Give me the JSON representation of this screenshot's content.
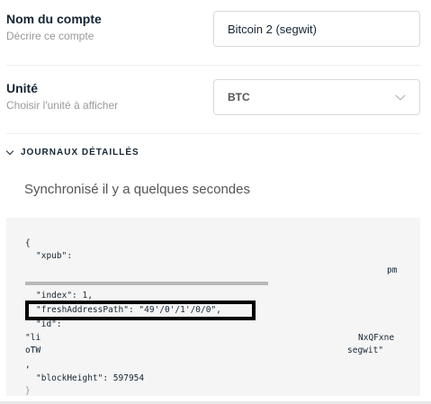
{
  "account_name": {
    "title": "Nom du compte",
    "description": "Décrire ce compte",
    "value": "Bitcoin 2 (segwit)"
  },
  "unit": {
    "title": "Unité",
    "description": "Choisir l'unité à afficher",
    "selected": "BTC"
  },
  "logs": {
    "toggle_label": "JOURNAUX DÉTAILLÉS",
    "sync_status": "Synchronisé il y a quelques secondes",
    "lines": {
      "open_brace": "{",
      "xpub_key": "\"xpub\":",
      "xpub_tail": "pm",
      "index": "\"index\": 1,",
      "fresh_path": "\"freshAddressPath\": \"49'/0'/1'/0/0\",",
      "id_key": "\"id\":",
      "id_start": "\"li",
      "id_mid_right": "NxQFxne",
      "id_line2_left": "oTW",
      "id_line2_right": "segwit\"",
      "comma": ",",
      "block_height": "\"blockHeight\": 597954",
      "close_brace": "}"
    }
  }
}
